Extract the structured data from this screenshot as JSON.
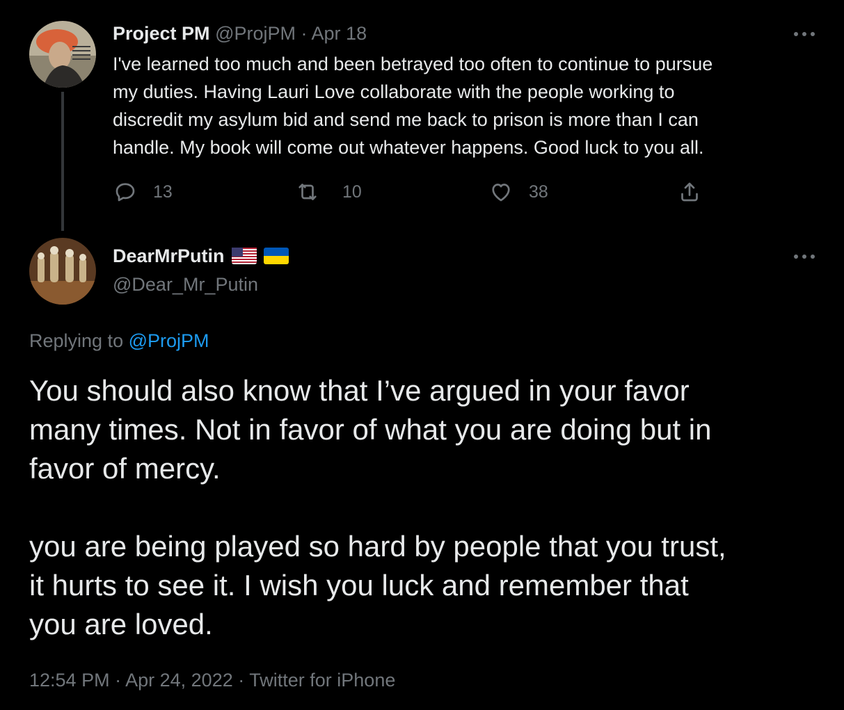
{
  "parent_tweet": {
    "author_name": "Project PM",
    "handle": "@ProjPM",
    "separator": "·",
    "date": "Apr 18",
    "text_lines": [
      "I've learned too much and been betrayed too often to continue to pursue",
      "my duties. Having Lauri Love collaborate with the people working to",
      "discredit my asylum bid and send me back to prison is more than I can",
      "handle. My book will come out whatever happens. Good luck to you all."
    ],
    "reply_count": "13",
    "retweet_count": "10",
    "like_count": "38",
    "icons": {
      "reply": "reply-icon",
      "retweet": "retweet-icon",
      "like": "heart-icon",
      "share": "share-icon",
      "more": "more-icon"
    }
  },
  "reply_tweet": {
    "author_name": "DearMrPutin",
    "flags": [
      "us-flag-icon",
      "ukraine-flag-icon"
    ],
    "handle": "@Dear_Mr_Putin",
    "replying_prefix": "Replying to",
    "replying_handle": "@ProjPM",
    "paragraph1_lines": [
      "You should also know that I’ve argued in your favor",
      "many times. Not in favor of what you are doing but in",
      "favor of mercy."
    ],
    "paragraph2_lines": [
      "you are being played so hard by people that you trust,",
      "it hurts to see it. I wish you luck and remember that",
      "you are loved."
    ],
    "time": "12:54 PM",
    "date": "Apr 24, 2022",
    "source": "Twitter for iPhone",
    "separator": "·"
  },
  "colors": {
    "background": "#000000",
    "text": "#e7e9ea",
    "muted": "#71767b",
    "link": "#1d9bf0",
    "thread_line": "#333639"
  }
}
